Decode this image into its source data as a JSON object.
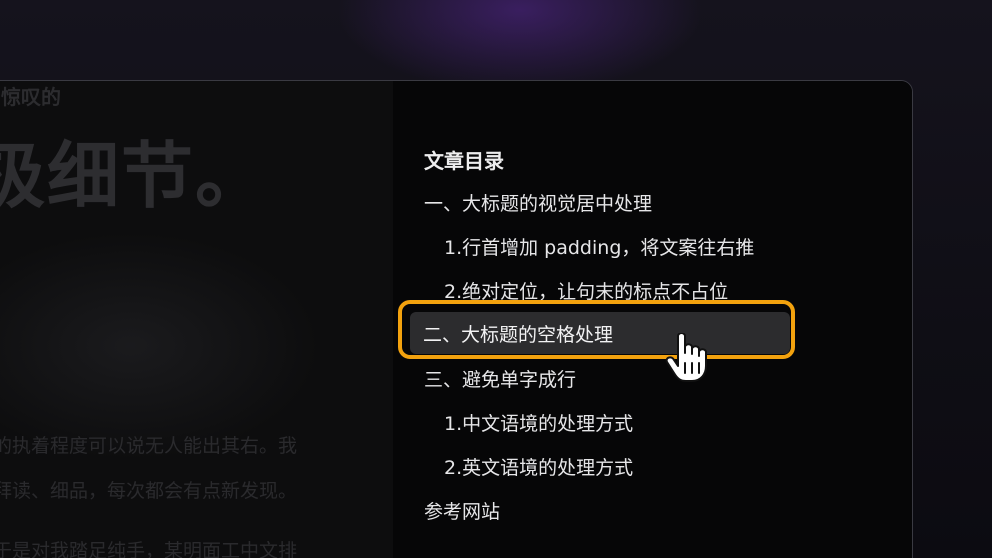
{
  "article": {
    "kicker": "惊叹的",
    "headline": "极细节。",
    "paragraphs": [
      "的执着程度可以说无人能出其右。我",
      "拜读、细品，每次都会有点新发现。",
      "于是对我踏足纯手，某明面工中文排"
    ]
  },
  "toc": {
    "title": "文章目录",
    "items": [
      {
        "label": "一、大标题的视觉居中处理",
        "level": 1
      },
      {
        "label": "1.行首增加 padding，将文案往右推",
        "level": 2
      },
      {
        "label": "2.绝对定位，让句末的标点不占位",
        "level": 2
      },
      {
        "label": "二、大标题的空格处理",
        "level": 1,
        "active": true
      },
      {
        "label": "三、避免单字成行",
        "level": 1
      },
      {
        "label": "1.中文语境的处理方式",
        "level": 2
      },
      {
        "label": "2.英文语境的处理方式",
        "level": 2
      },
      {
        "label": "参考网站",
        "level": 1
      }
    ]
  },
  "colors": {
    "accent_focus": "#f3a20e",
    "active_row_bg": "#2c2c2e",
    "text_primary": "#e6e6e8"
  },
  "icons": {
    "cursor": "hand-pointer-icon"
  }
}
